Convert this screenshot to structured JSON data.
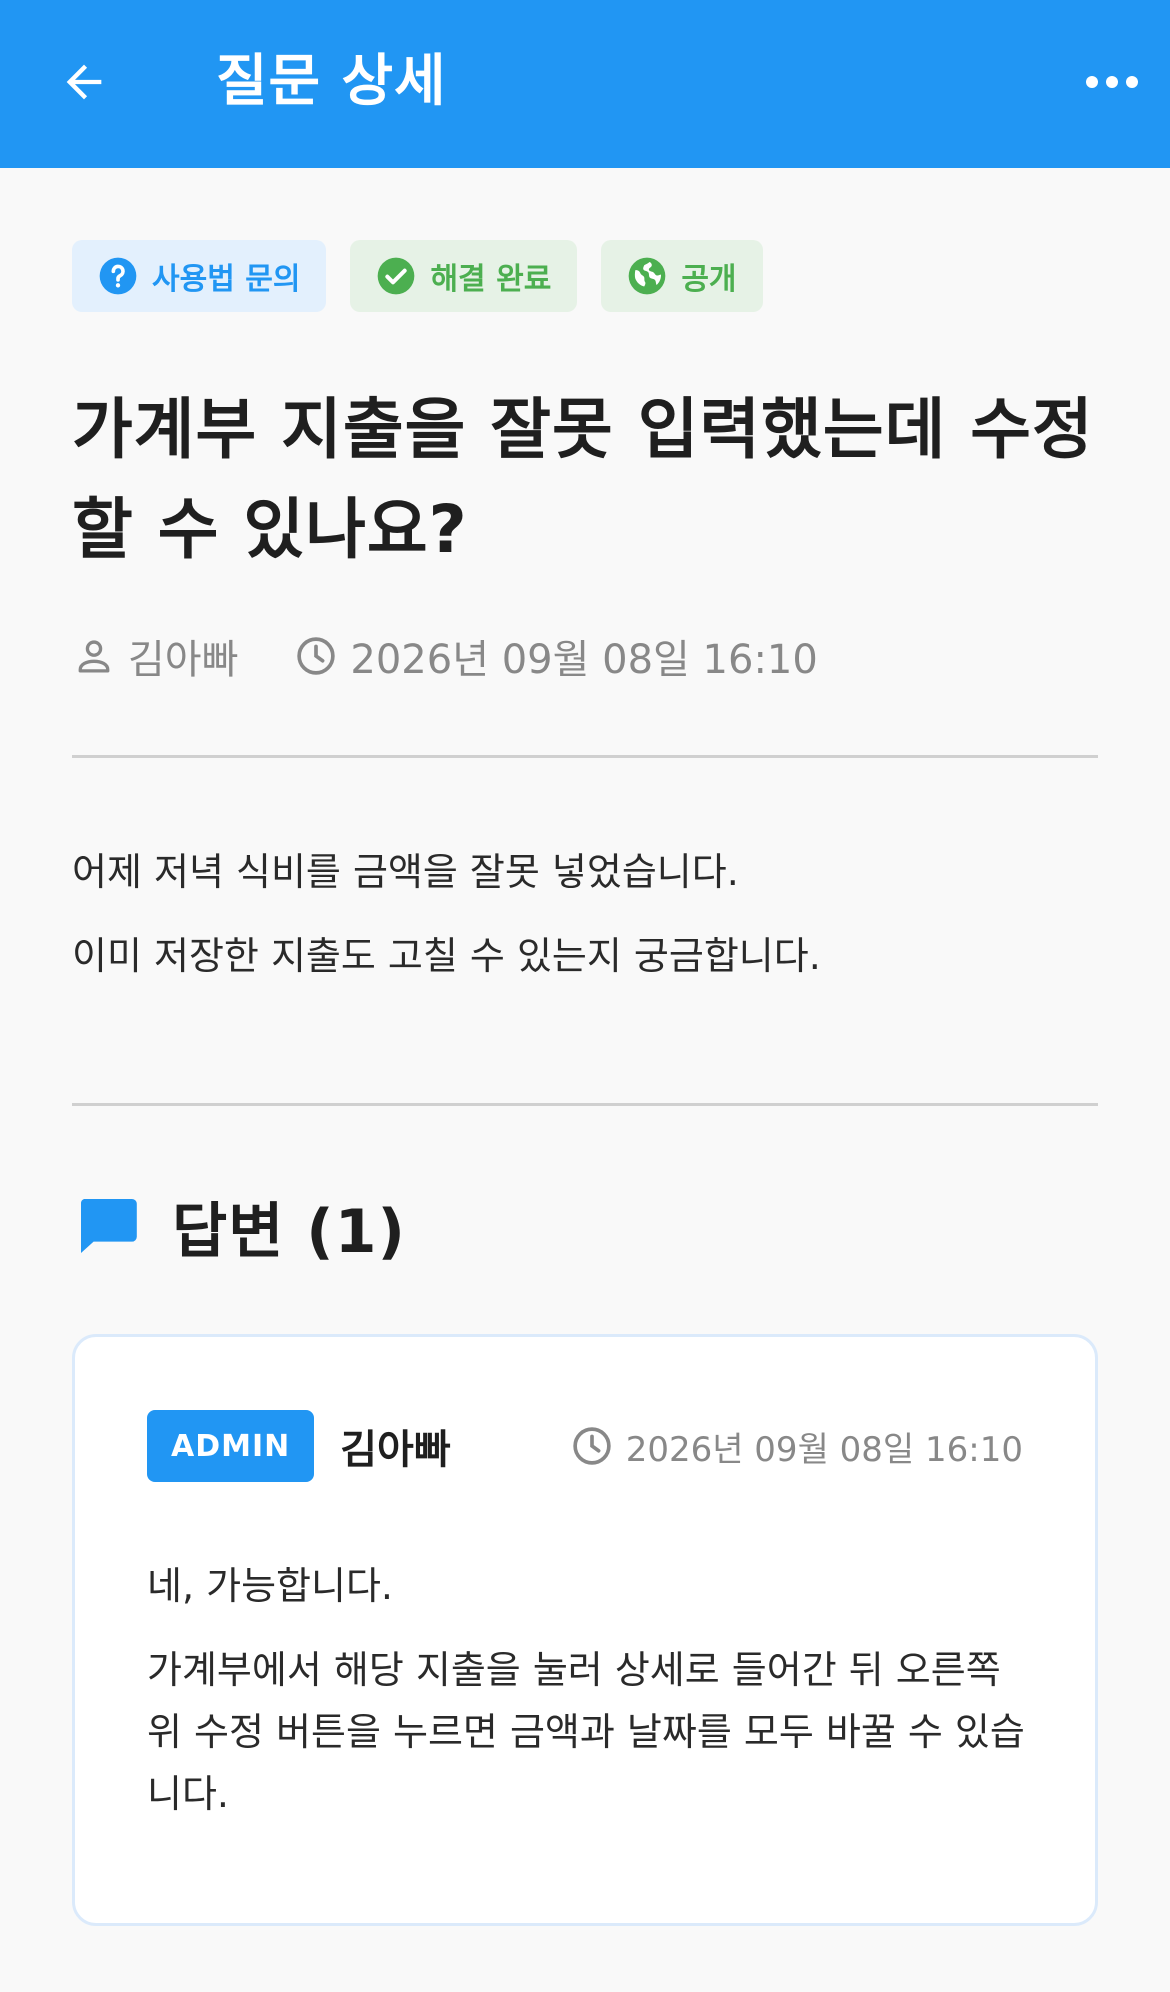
{
  "appbar": {
    "title": "질문 상세",
    "back_icon": "arrow-back-icon",
    "more_icon": "more-horiz-icon",
    "background": "#2196f3"
  },
  "chips": [
    {
      "label": "사용법 문의",
      "icon": "help-circle-icon",
      "color": "#2196f3"
    },
    {
      "label": "해결 완료",
      "icon": "check-circle-icon",
      "color": "#4caf50"
    },
    {
      "label": "공개",
      "icon": "globe-icon",
      "color": "#4caf50"
    }
  ],
  "question": {
    "title": "가계부 지출을 잘못 입력했는데 수정할 수 있나요?",
    "author": "김아빠",
    "datetime": "2026년 09월 08일 16:10",
    "body": [
      "어제 저녁 식비를 금액을 잘못 넣었습니다.",
      "이미 저장한 지출도 고칠 수 있는지 궁금합니다."
    ]
  },
  "answers": {
    "heading": "답변 (1)",
    "items": [
      {
        "badge": "ADMIN",
        "author": "김아빠",
        "datetime": "2026년 09월 08일 16:10",
        "paragraphs": [
          "네, 가능합니다.",
          "가계부에서 해당 지출을 눌러 상세로 들어간 뒤 오른쪽 위 수정 버튼을 누르면 금액과 날짜를 모두 바꿀 수 있습니다."
        ]
      }
    ]
  }
}
